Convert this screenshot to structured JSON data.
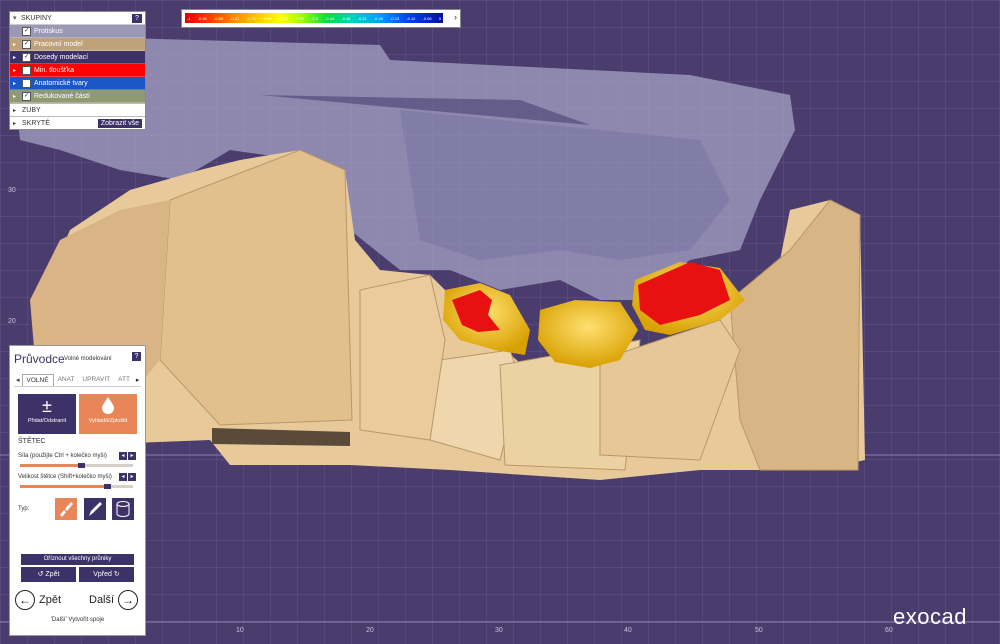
{
  "groups": {
    "header": "SKUPINY",
    "help": "?",
    "rows": [
      {
        "label": "Protiskus",
        "checked": true,
        "color": "#9b98b6"
      },
      {
        "label": "Pracovní model",
        "checked": true,
        "color": "#c0a27a"
      },
      {
        "label": "Dosedy modelací",
        "checked": true,
        "color": "#3d3268"
      },
      {
        "label": "Min. tloušťka",
        "checked": false,
        "color": "#ff0000"
      },
      {
        "label": "Anatomické tvary",
        "checked": false,
        "color": "#1a56c8"
      },
      {
        "label": "Redukované části",
        "checked": true,
        "color": "#8f9a70"
      }
    ],
    "teeth": "ZUBY",
    "hidden": "SKRYTÉ",
    "show_all": "Zobrazit vše"
  },
  "scale": {
    "labels": [
      "-1",
      "-0.94",
      "-0.88",
      "-0.81",
      "-0.75",
      "-0.69",
      "-0.62",
      "-0.56",
      "-0.5",
      "-0.44",
      "-0.38",
      "-0.31",
      "-0.25",
      "-0.19",
      "-0.12",
      "-0.06",
      "0"
    ],
    "arrow": "›"
  },
  "wizard": {
    "title": "Průvodce",
    "subtitle": "Volné modelování",
    "help": "?",
    "tabs": [
      "VOLNÉ",
      "ANAT",
      "UPRAVIT",
      "ATT"
    ],
    "add_remove": "Přidat/Odstranit",
    "add_remove_symbol": "±",
    "smooth": "Vyhladit/Zploštit",
    "brush_heading": "ŠTĚTEC",
    "strength_label": "Síla (použijte Ctrl + kolečko myši)",
    "strength_value": 0.55,
    "size_label": "Velikost štětce (Shift+kolečko myši)",
    "size_value": 0.78,
    "type_label": "Typ:",
    "cut_all": "Oříznout všechny průniky",
    "undo": "Zpět",
    "redo": "Vpřed",
    "back": "Zpět",
    "next": "Další",
    "hint": "'Další' Vytvořit spoje"
  },
  "axis": {
    "x_ticks": [
      "10",
      "20",
      "30",
      "40",
      "50",
      "60"
    ],
    "y_ticks": [
      "30",
      "20"
    ]
  },
  "colors": {
    "background": "#4b3c6e",
    "model": "#e8c99a",
    "antagonist": "#a8a6c8",
    "accent": "#3d3268",
    "brush_active": "#e8865a"
  },
  "logo": "exocad"
}
